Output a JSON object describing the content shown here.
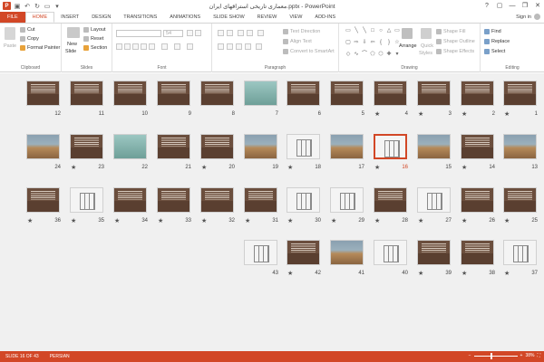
{
  "window": {
    "title": "معماری تاریخی استراقهای ایران.pptx - PowerPoint",
    "app_icon": "P",
    "controls": [
      "?",
      "▢",
      "—",
      "❐",
      "✕"
    ]
  },
  "tabs": [
    {
      "label": "FILE",
      "kind": "file"
    },
    {
      "label": "HOME",
      "kind": "active"
    },
    {
      "label": "INSERT"
    },
    {
      "label": "DESIGN"
    },
    {
      "label": "TRANSITIONS"
    },
    {
      "label": "ANIMATIONS"
    },
    {
      "label": "SLIDE SHOW"
    },
    {
      "label": "REVIEW"
    },
    {
      "label": "VIEW"
    },
    {
      "label": "ADD-INS"
    }
  ],
  "signin": "Sign in",
  "ribbon": {
    "clipboard": {
      "label": "Clipboard",
      "paste": "Paste",
      "cut": "Cut",
      "copy": "Copy",
      "format_painter": "Format Painter"
    },
    "slides": {
      "label": "Slides",
      "new_slide": "New",
      "new_slide2": "Slide",
      "layout": "Layout",
      "reset": "Reset",
      "section": "Section"
    },
    "font": {
      "label": "Font",
      "size": "54"
    },
    "paragraph": {
      "label": "Paragraph",
      "text_direction": "Text Direction",
      "align_text": "Align Text",
      "convert": "Convert to SmartArt"
    },
    "drawing": {
      "label": "Drawing",
      "arrange": "Arrange",
      "quick_styles": "Quick",
      "quick_styles2": "Styles",
      "shape_fill": "Shape Fill",
      "shape_outline": "Shape Outline",
      "shape_effects": "Shape Effects"
    },
    "editing": {
      "label": "Editing",
      "find": "Find",
      "replace": "Replace",
      "select": "Select"
    }
  },
  "slides": [
    {
      "n": "1",
      "star": true,
      "kind": "text"
    },
    {
      "n": "2",
      "star": true,
      "kind": "text"
    },
    {
      "n": "3",
      "star": true,
      "kind": "text"
    },
    {
      "n": "4",
      "star": true,
      "kind": "text"
    },
    {
      "n": "5",
      "star": false,
      "kind": "text"
    },
    {
      "n": "6",
      "star": false,
      "kind": "text"
    },
    {
      "n": "7",
      "star": false,
      "kind": "teal"
    },
    {
      "n": "8",
      "star": false,
      "kind": "text"
    },
    {
      "n": "9",
      "star": false,
      "kind": "text"
    },
    {
      "n": "10",
      "star": false,
      "kind": "text"
    },
    {
      "n": "11",
      "star": false,
      "kind": "text"
    },
    {
      "n": "12",
      "star": false,
      "kind": "text"
    },
    {
      "n": "13",
      "star": false,
      "kind": "photo"
    },
    {
      "n": "14",
      "star": true,
      "kind": "text"
    },
    {
      "n": "15",
      "star": false,
      "kind": "photo"
    },
    {
      "n": "16",
      "star": true,
      "kind": "plan",
      "selected": true
    },
    {
      "n": "17",
      "star": false,
      "kind": "photo"
    },
    {
      "n": "18",
      "star": true,
      "kind": "plan"
    },
    {
      "n": "19",
      "star": false,
      "kind": "photo"
    },
    {
      "n": "20",
      "star": true,
      "kind": "text"
    },
    {
      "n": "21",
      "star": false,
      "kind": "text"
    },
    {
      "n": "22",
      "star": false,
      "kind": "teal"
    },
    {
      "n": "23",
      "star": true,
      "kind": "text"
    },
    {
      "n": "24",
      "star": false,
      "kind": "photo"
    },
    {
      "n": "25",
      "star": true,
      "kind": "text"
    },
    {
      "n": "26",
      "star": true,
      "kind": "text"
    },
    {
      "n": "27",
      "star": true,
      "kind": "plan"
    },
    {
      "n": "28",
      "star": true,
      "kind": "text"
    },
    {
      "n": "29",
      "star": true,
      "kind": "plan"
    },
    {
      "n": "30",
      "star": true,
      "kind": "plan"
    },
    {
      "n": "31",
      "star": true,
      "kind": "text"
    },
    {
      "n": "32",
      "star": true,
      "kind": "text"
    },
    {
      "n": "33",
      "star": true,
      "kind": "text"
    },
    {
      "n": "34",
      "star": true,
      "kind": "text"
    },
    {
      "n": "35",
      "star": true,
      "kind": "plan"
    },
    {
      "n": "36",
      "star": true,
      "kind": "text"
    },
    {
      "n": "37",
      "star": true,
      "kind": "plan"
    },
    {
      "n": "38",
      "star": true,
      "kind": "text"
    },
    {
      "n": "39",
      "star": true,
      "kind": "text"
    },
    {
      "n": "40",
      "star": false,
      "kind": "plan"
    },
    {
      "n": "41",
      "star": false,
      "kind": "photo"
    },
    {
      "n": "42",
      "star": true,
      "kind": "text"
    },
    {
      "n": "43",
      "star": false,
      "kind": "plan"
    }
  ],
  "status": {
    "slide_info": "SLIDE 16 OF 43",
    "language": "PERSIAN",
    "zoom": "38%",
    "zoom_fraction": 0.38
  },
  "colors": {
    "accent": "#d24726",
    "sorter_bg": "#f0f0f0"
  }
}
